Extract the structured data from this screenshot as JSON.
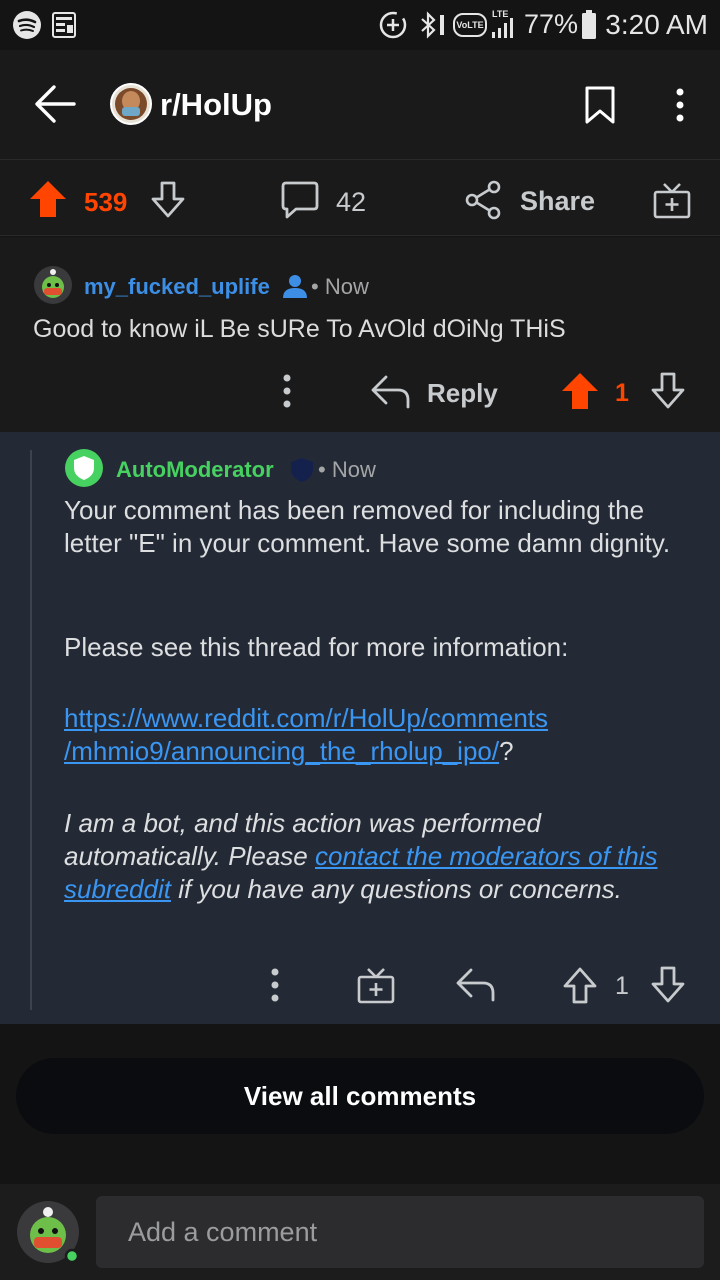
{
  "status_bar": {
    "battery": "77%",
    "time": "3:20 AM",
    "network": "LTE",
    "volte": "VoLTE"
  },
  "header": {
    "subreddit": "r/HolUp"
  },
  "post_actions": {
    "score": "539",
    "comments": "42",
    "share": "Share"
  },
  "comments": [
    {
      "username": "my_fucked_uplife",
      "time": "Now",
      "body": "Good to know iL Be sURe To AvOld dOiNg THiS",
      "reply": "Reply",
      "score": "1"
    },
    {
      "username": "AutoModerator",
      "time": "Now",
      "paragraph1": "Your comment has been removed for including the letter \"E\" in your comment.  Have some damn dignity.",
      "paragraph2": "Please see this thread for more information:",
      "link_line1": "https://www.reddit.com/r/HolUp/comments",
      "link_line2": "/mhmio9/announcing_the_rholup_ipo/",
      "link_suffix": "?",
      "bot_text1": "I am a bot, and this action was performed automatically. Please ",
      "bot_link": "contact the moderators of this subreddit",
      "bot_text2": " if you have any questions or concerns.",
      "score": "1"
    }
  ],
  "view_all": "View all comments",
  "composer": {
    "placeholder": "Add a comment"
  },
  "colors": {
    "upvote": "#ff4500",
    "link": "#3a96f3",
    "mod_green": "#46d160",
    "username_blue": "#3d8ee5"
  }
}
